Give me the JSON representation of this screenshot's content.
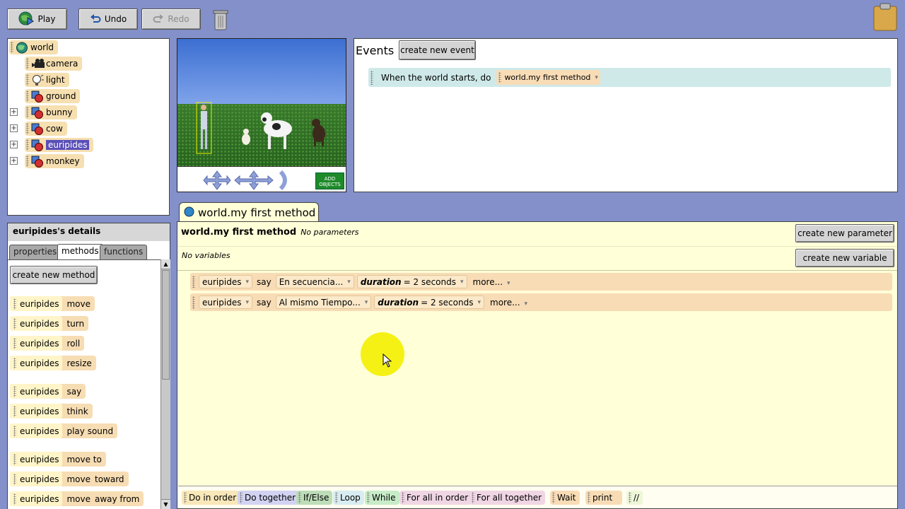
{
  "toolbar": {
    "play": "Play",
    "undo": "Undo",
    "redo": "Redo"
  },
  "tree": {
    "items": [
      {
        "label": "world"
      },
      {
        "label": "camera"
      },
      {
        "label": "light"
      },
      {
        "label": "ground"
      },
      {
        "label": "bunny"
      },
      {
        "label": "cow"
      },
      {
        "label": "euripides"
      },
      {
        "label": "monkey"
      }
    ]
  },
  "world_view": {
    "add_objects": "ADD OBJECTS"
  },
  "events": {
    "title": "Events",
    "create_button": "create new event",
    "rule": {
      "prefix": "When the world starts, do",
      "method": "world.my first method"
    }
  },
  "details": {
    "title": "euripides's details",
    "tabs": [
      "properties",
      "methods",
      "functions"
    ],
    "create_button": "create new method",
    "methods": [
      {
        "obj": "euripides",
        "verb": "move"
      },
      {
        "obj": "euripides",
        "verb": "turn"
      },
      {
        "obj": "euripides",
        "verb": "roll"
      },
      {
        "obj": "euripides",
        "verb": "resize"
      },
      {
        "obj": "euripides",
        "verb": "say"
      },
      {
        "obj": "euripides",
        "verb": "think"
      },
      {
        "obj": "euripides",
        "verb": "play sound"
      },
      {
        "obj": "euripides",
        "verb": "move to"
      },
      {
        "obj": "euripides",
        "verb": "move",
        "extra": "toward"
      },
      {
        "obj": "euripides",
        "verb": "move",
        "extra": "away from"
      }
    ]
  },
  "editor": {
    "tab_label": "world.my first method",
    "method_name": "world.my first method",
    "no_params": "No parameters",
    "no_vars": "No variables",
    "create_param": "create new parameter",
    "create_var": "create new variable",
    "statements": [
      {
        "obj": "euripides",
        "verb": "say",
        "text": "En secuencia...",
        "param": "duration",
        "value": "= 2 seconds",
        "more": "more..."
      },
      {
        "obj": "euripides",
        "verb": "say",
        "text": "Al mismo Tiempo...",
        "param": "duration",
        "value": "= 2 seconds",
        "more": "more..."
      }
    ],
    "palette": [
      "Do in order",
      "Do together",
      "If/Else",
      "Loop",
      "While",
      "For all in order",
      "For all together",
      "Wait",
      "print",
      "//"
    ]
  }
}
